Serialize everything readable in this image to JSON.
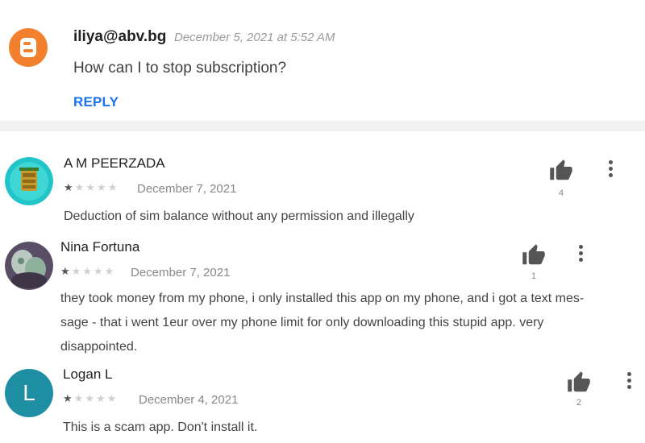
{
  "blog_comment": {
    "author": "iliya@abv.bg",
    "date": "December 5, 2021 at 5:52 AM",
    "text": "How can I to stop subscription?",
    "reply_label": "REPLY",
    "avatar_icon": "blogger-icon",
    "avatar_color": "#f3802c"
  },
  "reviews": [
    {
      "name": "A M PEERZADA",
      "rating": 1,
      "date": "December 7, 2021",
      "text": "Deduction of sim balance without any permission and illegally",
      "helpful_count": "4"
    },
    {
      "name": "Nina Fortuna",
      "rating": 1,
      "date": "December 7, 2021",
      "text_lines": [
        "they took money from my phone, i only installed this app on my phone, and i got a text mes-",
        "sage - that i went 1eur over my phone limit for only downloading this stupid app. very",
        "disappointed."
      ],
      "helpful_count": "1"
    },
    {
      "name": "Logan L",
      "avatar_letter": "L",
      "avatar_color": "#1e8fa3",
      "rating": 1,
      "date": "December 4, 2021",
      "text": "This is a scam app. Don't install it.",
      "helpful_count": "2"
    }
  ],
  "stars_total": 5,
  "icons": {
    "like": "thumbs-up-icon",
    "menu": "more-vert-icon"
  }
}
